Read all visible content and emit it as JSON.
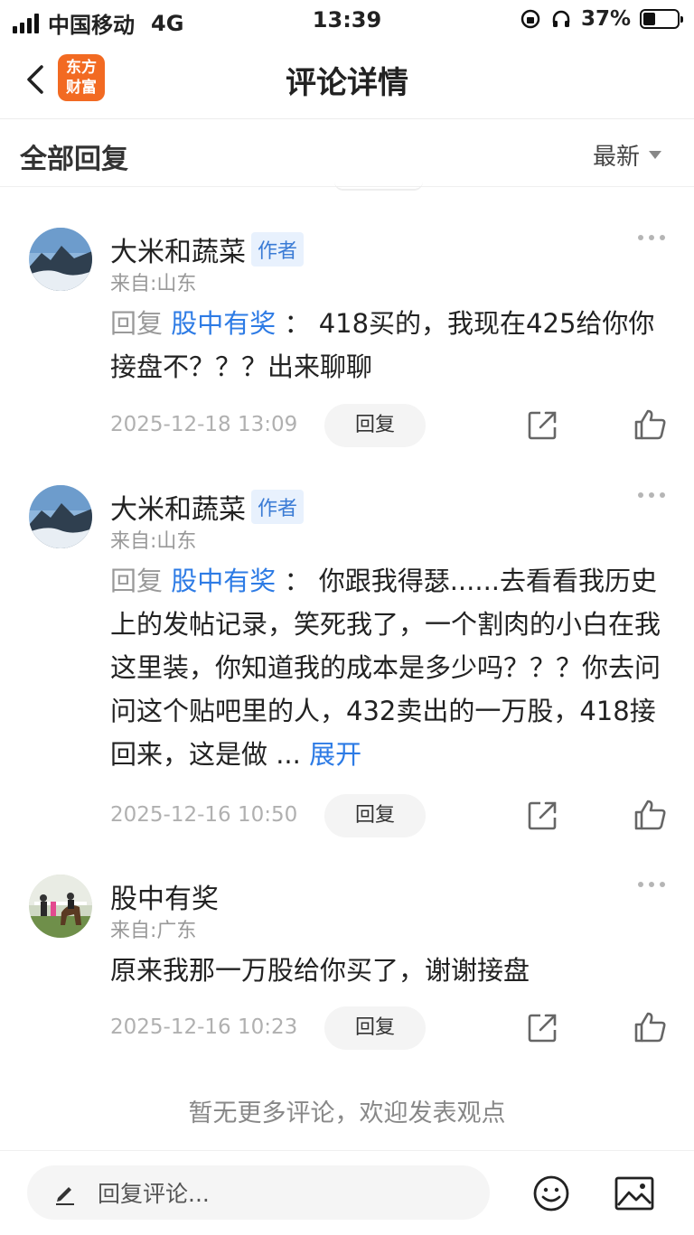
{
  "status_bar": {
    "carrier": "中国移动",
    "network": "4G",
    "time": "13:39",
    "battery": "37%",
    "battery_level": 0.37
  },
  "nav": {
    "logo_line1": "东方",
    "logo_line2": "财富",
    "title": "评论详情",
    "logo_color": "#f26a22"
  },
  "filter": {
    "title": "全部回复",
    "sort_label": "最新"
  },
  "comments": [
    {
      "user": "大米和蔬菜",
      "tag": "作者",
      "from": "来自:山东",
      "reply_prefix": "回复",
      "reply_to": "股中有奖",
      "separator": "：",
      "text": "418买的，我现在425给你你接盘不？？？出来聊聊",
      "date": "2025-12-18 13:09",
      "reply_label": "回复"
    },
    {
      "user": "大米和蔬菜",
      "tag": "作者",
      "from": "来自:山东",
      "reply_prefix": "回复",
      "reply_to": "股中有奖",
      "separator": "：",
      "text": "你跟我得瑟......去看看我历史上的发帖记录，笑死我了，一个割肉的小白在我这里装，你知道我的成本是多少吗？？？你去问问这个贴吧里的人，432卖出的一万股，418接回来，这是做 ...",
      "expand": "展开",
      "date": "2025-12-16 10:50",
      "reply_label": "回复"
    },
    {
      "user": "股中有奖",
      "from": "来自:广东",
      "text": "原来我那一万股给你买了，谢谢接盘",
      "date": "2025-12-16 10:23",
      "reply_label": "回复"
    }
  ],
  "footer_note": "暂无更多评论，欢迎发表观点",
  "bottom_bar": {
    "placeholder": "回复评论..."
  },
  "icons": [
    "back-icon",
    "signal-icon",
    "battery-icon",
    "caret-down-icon",
    "more-icon",
    "share-icon",
    "like-icon",
    "pencil-icon",
    "emoji-icon",
    "image-icon"
  ]
}
